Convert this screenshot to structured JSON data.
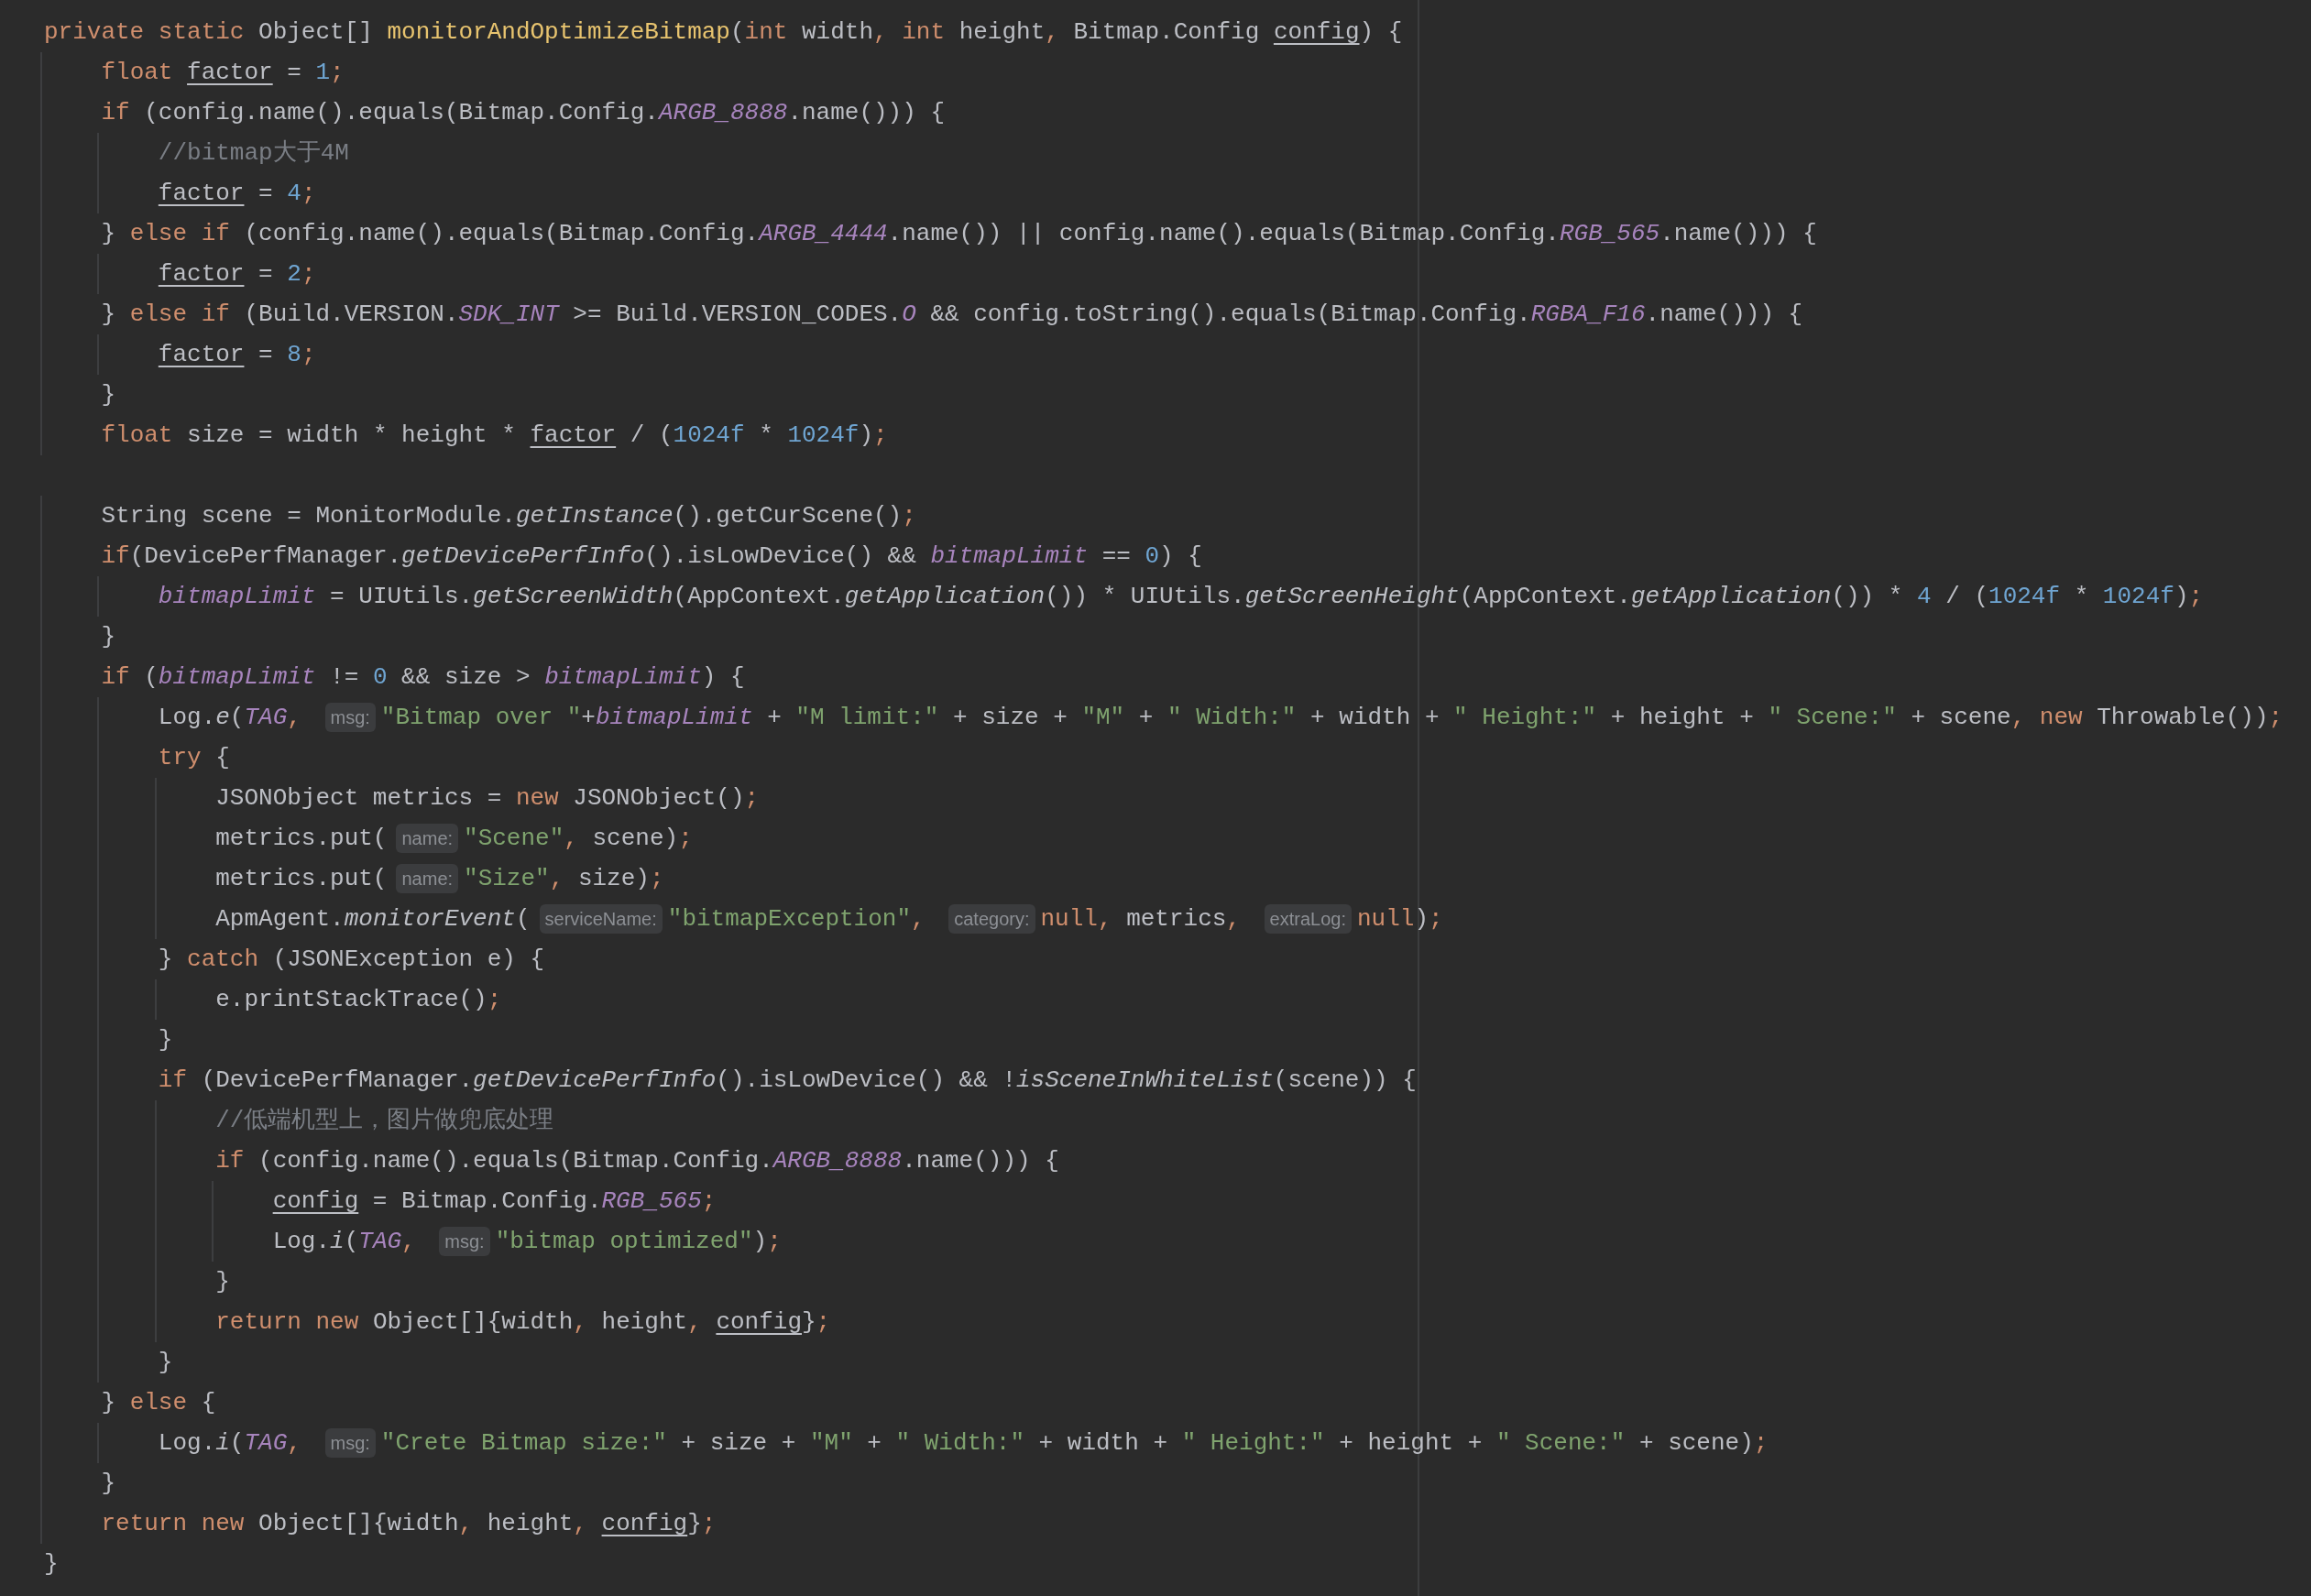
{
  "editor": {
    "lines": [
      {
        "tokens": [
          {
            "kind": "kw",
            "text": "private static "
          },
          {
            "kind": "id",
            "text": "Object[] "
          },
          {
            "kind": "fn",
            "text": "monitorAndOptimizeBitmap"
          },
          {
            "kind": "id",
            "text": "("
          },
          {
            "kind": "kw",
            "text": "int "
          },
          {
            "kind": "id",
            "text": "width"
          },
          {
            "kind": "kw",
            "text": ", int "
          },
          {
            "kind": "id",
            "text": "height"
          },
          {
            "kind": "kw",
            "text": ", "
          },
          {
            "kind": "id",
            "text": "Bitmap.Config "
          },
          {
            "kind": "var",
            "text": "config"
          },
          {
            "kind": "id",
            "text": ") {"
          }
        ]
      },
      {
        "tokens": [
          {
            "kind": "kw",
            "text": "    float "
          },
          {
            "kind": "var",
            "text": "factor"
          },
          {
            "kind": "id",
            "text": " = "
          },
          {
            "kind": "num",
            "text": "1"
          },
          {
            "kind": "kw",
            "text": ";"
          }
        ]
      },
      {
        "tokens": [
          {
            "kind": "kw",
            "text": "    if "
          },
          {
            "kind": "id",
            "text": "(config.name().equals(Bitmap.Config."
          },
          {
            "kind": "const",
            "text": "ARGB_8888"
          },
          {
            "kind": "id",
            "text": ".name())) {"
          }
        ]
      },
      {
        "tokens": [
          {
            "kind": "cmt",
            "text": "        //bitmap大于4M"
          }
        ]
      },
      {
        "tokens": [
          {
            "kind": "var",
            "text": "        factor"
          },
          {
            "kind": "id",
            "text": " = "
          },
          {
            "kind": "num",
            "text": "4"
          },
          {
            "kind": "kw",
            "text": ";"
          }
        ]
      },
      {
        "tokens": [
          {
            "kind": "id",
            "text": "    } "
          },
          {
            "kind": "kw",
            "text": "else if "
          },
          {
            "kind": "id",
            "text": "(config.name().equals(Bitmap.Config."
          },
          {
            "kind": "const",
            "text": "ARGB_4444"
          },
          {
            "kind": "id",
            "text": ".name()) || config.name().equals(Bitmap.Config."
          },
          {
            "kind": "const",
            "text": "RGB_565"
          },
          {
            "kind": "id",
            "text": ".name())) {"
          }
        ]
      },
      {
        "tokens": [
          {
            "kind": "var",
            "text": "        factor"
          },
          {
            "kind": "id",
            "text": " = "
          },
          {
            "kind": "num",
            "text": "2"
          },
          {
            "kind": "kw",
            "text": ";"
          }
        ]
      },
      {
        "tokens": [
          {
            "kind": "id",
            "text": "    } "
          },
          {
            "kind": "kw",
            "text": "else if "
          },
          {
            "kind": "id",
            "text": "(Build.VERSION."
          },
          {
            "kind": "const",
            "text": "SDK_INT"
          },
          {
            "kind": "id",
            "text": " >= Build.VERSION_CODES."
          },
          {
            "kind": "const",
            "text": "O"
          },
          {
            "kind": "id",
            "text": " && config.toString().equals(Bitmap.Config."
          },
          {
            "kind": "const",
            "text": "RGBA_F16"
          },
          {
            "kind": "id",
            "text": ".name())) {"
          }
        ]
      },
      {
        "tokens": [
          {
            "kind": "var",
            "text": "        factor"
          },
          {
            "kind": "id",
            "text": " = "
          },
          {
            "kind": "num",
            "text": "8"
          },
          {
            "kind": "kw",
            "text": ";"
          }
        ]
      },
      {
        "tokens": [
          {
            "kind": "id",
            "text": "    }"
          }
        ]
      },
      {
        "tokens": [
          {
            "kind": "kw",
            "text": "    float "
          },
          {
            "kind": "id",
            "text": "size = width * height * "
          },
          {
            "kind": "var",
            "text": "factor"
          },
          {
            "kind": "id",
            "text": " / ("
          },
          {
            "kind": "num",
            "text": "1024f"
          },
          {
            "kind": "id",
            "text": " * "
          },
          {
            "kind": "num",
            "text": "1024f"
          },
          {
            "kind": "id",
            "text": ")"
          },
          {
            "kind": "kw",
            "text": ";"
          }
        ]
      },
      {
        "blank": true
      },
      {
        "tokens": [
          {
            "kind": "id",
            "text": "    String scene = MonitorModule."
          },
          {
            "kind": "call",
            "text": "getInstance"
          },
          {
            "kind": "id",
            "text": "().getCurScene()"
          },
          {
            "kind": "kw",
            "text": ";"
          }
        ]
      },
      {
        "tokens": [
          {
            "kind": "kw",
            "text": "    if"
          },
          {
            "kind": "id",
            "text": "(DevicePerfManager."
          },
          {
            "kind": "call",
            "text": "getDevicePerfInfo"
          },
          {
            "kind": "id",
            "text": "().isLowDevice() && "
          },
          {
            "kind": "const",
            "text": "bitmapLimit"
          },
          {
            "kind": "id",
            "text": " == "
          },
          {
            "kind": "num",
            "text": "0"
          },
          {
            "kind": "id",
            "text": ") {"
          }
        ]
      },
      {
        "tokens": [
          {
            "kind": "const",
            "text": "        bitmapLimit"
          },
          {
            "kind": "id",
            "text": " = UIUtils."
          },
          {
            "kind": "call",
            "text": "getScreenWidth"
          },
          {
            "kind": "id",
            "text": "(AppContext."
          },
          {
            "kind": "call",
            "text": "getApplication"
          },
          {
            "kind": "id",
            "text": "()) * UIUtils."
          },
          {
            "kind": "call",
            "text": "getScreenHeight"
          },
          {
            "kind": "id",
            "text": "(AppContext."
          },
          {
            "kind": "call",
            "text": "getApplication"
          },
          {
            "kind": "id",
            "text": "()) * "
          },
          {
            "kind": "num",
            "text": "4"
          },
          {
            "kind": "id",
            "text": " / ("
          },
          {
            "kind": "num",
            "text": "1024f"
          },
          {
            "kind": "id",
            "text": " * "
          },
          {
            "kind": "num",
            "text": "1024f"
          },
          {
            "kind": "id",
            "text": ")"
          },
          {
            "kind": "kw",
            "text": ";"
          }
        ]
      },
      {
        "tokens": [
          {
            "kind": "id",
            "text": "    }"
          }
        ]
      },
      {
        "tokens": [
          {
            "kind": "kw",
            "text": "    if "
          },
          {
            "kind": "id",
            "text": "("
          },
          {
            "kind": "const",
            "text": "bitmapLimit"
          },
          {
            "kind": "id",
            "text": " != "
          },
          {
            "kind": "num",
            "text": "0"
          },
          {
            "kind": "id",
            "text": " && size > "
          },
          {
            "kind": "const",
            "text": "bitmapLimit"
          },
          {
            "kind": "id",
            "text": ") {"
          }
        ]
      },
      {
        "tokens": [
          {
            "kind": "id",
            "text": "        Log."
          },
          {
            "kind": "call",
            "text": "e"
          },
          {
            "kind": "id",
            "text": "("
          },
          {
            "kind": "const",
            "text": "TAG"
          },
          {
            "kind": "kw",
            "text": ", "
          },
          {
            "kind": "hint",
            "text": "msg:"
          },
          {
            "kind": "str",
            "text": "\"Bitmap over \""
          },
          {
            "kind": "id",
            "text": "+"
          },
          {
            "kind": "const",
            "text": "bitmapLimit"
          },
          {
            "kind": "id",
            "text": " + "
          },
          {
            "kind": "str",
            "text": "\"M limit:\""
          },
          {
            "kind": "id",
            "text": " + size + "
          },
          {
            "kind": "str",
            "text": "\"M\""
          },
          {
            "kind": "id",
            "text": " + "
          },
          {
            "kind": "str",
            "text": "\" Width:\""
          },
          {
            "kind": "id",
            "text": " + width + "
          },
          {
            "kind": "str",
            "text": "\" Height:\""
          },
          {
            "kind": "id",
            "text": " + height + "
          },
          {
            "kind": "str",
            "text": "\" Scene:\""
          },
          {
            "kind": "id",
            "text": " + scene"
          },
          {
            "kind": "kw",
            "text": ", new "
          },
          {
            "kind": "id",
            "text": "Throwable())"
          },
          {
            "kind": "kw",
            "text": ";"
          }
        ]
      },
      {
        "tokens": [
          {
            "kind": "kw",
            "text": "        try "
          },
          {
            "kind": "id",
            "text": "{"
          }
        ]
      },
      {
        "tokens": [
          {
            "kind": "id",
            "text": "            JSONObject metrics = "
          },
          {
            "kind": "kw",
            "text": "new "
          },
          {
            "kind": "id",
            "text": "JSONObject()"
          },
          {
            "kind": "kw",
            "text": ";"
          }
        ]
      },
      {
        "tokens": [
          {
            "kind": "id",
            "text": "            metrics.put("
          },
          {
            "kind": "hint",
            "text": "name:"
          },
          {
            "kind": "str",
            "text": "\"Scene\""
          },
          {
            "kind": "kw",
            "text": ", "
          },
          {
            "kind": "id",
            "text": "scene)"
          },
          {
            "kind": "kw",
            "text": ";"
          }
        ]
      },
      {
        "tokens": [
          {
            "kind": "id",
            "text": "            metrics.put("
          },
          {
            "kind": "hint",
            "text": "name:"
          },
          {
            "kind": "str",
            "text": "\"Size\""
          },
          {
            "kind": "kw",
            "text": ", "
          },
          {
            "kind": "id",
            "text": "size)"
          },
          {
            "kind": "kw",
            "text": ";"
          }
        ]
      },
      {
        "tokens": [
          {
            "kind": "id",
            "text": "            ApmAgent."
          },
          {
            "kind": "call",
            "text": "monitorEvent"
          },
          {
            "kind": "id",
            "text": "("
          },
          {
            "kind": "hint",
            "text": "serviceName:"
          },
          {
            "kind": "str",
            "text": "\"bitmapException\""
          },
          {
            "kind": "kw",
            "text": ", "
          },
          {
            "kind": "hint",
            "text": "category:"
          },
          {
            "kind": "kw",
            "text": "null, "
          },
          {
            "kind": "id",
            "text": "metrics"
          },
          {
            "kind": "kw",
            "text": ", "
          },
          {
            "kind": "hint",
            "text": "extraLog:"
          },
          {
            "kind": "kw",
            "text": "null"
          },
          {
            "kind": "id",
            "text": ")"
          },
          {
            "kind": "kw",
            "text": ";"
          }
        ]
      },
      {
        "tokens": [
          {
            "kind": "id",
            "text": "        } "
          },
          {
            "kind": "kw",
            "text": "catch "
          },
          {
            "kind": "id",
            "text": "(JSONException e) {"
          }
        ]
      },
      {
        "tokens": [
          {
            "kind": "id",
            "text": "            e.printStackTrace()"
          },
          {
            "kind": "kw",
            "text": ";"
          }
        ]
      },
      {
        "tokens": [
          {
            "kind": "id",
            "text": "        }"
          }
        ]
      },
      {
        "tokens": [
          {
            "kind": "kw",
            "text": "        if "
          },
          {
            "kind": "id",
            "text": "(DevicePerfManager."
          },
          {
            "kind": "call",
            "text": "getDevicePerfInfo"
          },
          {
            "kind": "id",
            "text": "().isLowDevice() && !"
          },
          {
            "kind": "call",
            "text": "isSceneInWhiteList"
          },
          {
            "kind": "id",
            "text": "(scene)) {"
          }
        ]
      },
      {
        "tokens": [
          {
            "kind": "cmt",
            "text": "            //低端机型上，图片做兜底处理"
          }
        ]
      },
      {
        "tokens": [
          {
            "kind": "kw",
            "text": "            if "
          },
          {
            "kind": "id",
            "text": "(config.name().equals(Bitmap.Config."
          },
          {
            "kind": "const",
            "text": "ARGB_8888"
          },
          {
            "kind": "id",
            "text": ".name())) {"
          }
        ]
      },
      {
        "tokens": [
          {
            "kind": "var",
            "text": "                config"
          },
          {
            "kind": "id",
            "text": " = Bitmap.Config."
          },
          {
            "kind": "const",
            "text": "RGB_565"
          },
          {
            "kind": "kw",
            "text": ";"
          }
        ]
      },
      {
        "tokens": [
          {
            "kind": "id",
            "text": "                Log."
          },
          {
            "kind": "call",
            "text": "i"
          },
          {
            "kind": "id",
            "text": "("
          },
          {
            "kind": "const",
            "text": "TAG"
          },
          {
            "kind": "kw",
            "text": ", "
          },
          {
            "kind": "hint",
            "text": "msg:"
          },
          {
            "kind": "str",
            "text": "\"bitmap optimized\""
          },
          {
            "kind": "id",
            "text": ")"
          },
          {
            "kind": "kw",
            "text": ";"
          }
        ]
      },
      {
        "tokens": [
          {
            "kind": "id",
            "text": "            }"
          }
        ]
      },
      {
        "tokens": [
          {
            "kind": "kw",
            "text": "            return new "
          },
          {
            "kind": "id",
            "text": "Object[]{width"
          },
          {
            "kind": "kw",
            "text": ", "
          },
          {
            "kind": "id",
            "text": "height"
          },
          {
            "kind": "kw",
            "text": ", "
          },
          {
            "kind": "var",
            "text": "config"
          },
          {
            "kind": "id",
            "text": "}"
          },
          {
            "kind": "kw",
            "text": ";"
          }
        ]
      },
      {
        "tokens": [
          {
            "kind": "id",
            "text": "        }"
          }
        ]
      },
      {
        "tokens": [
          {
            "kind": "id",
            "text": "    } "
          },
          {
            "kind": "kw",
            "text": "else "
          },
          {
            "kind": "id",
            "text": "{"
          }
        ]
      },
      {
        "tokens": [
          {
            "kind": "id",
            "text": "        Log."
          },
          {
            "kind": "call",
            "text": "i"
          },
          {
            "kind": "id",
            "text": "("
          },
          {
            "kind": "const",
            "text": "TAG"
          },
          {
            "kind": "kw",
            "text": ", "
          },
          {
            "kind": "hint",
            "text": "msg:"
          },
          {
            "kind": "str",
            "text": "\"Crete Bitmap size:\""
          },
          {
            "kind": "id",
            "text": " + size + "
          },
          {
            "kind": "str",
            "text": "\"M\""
          },
          {
            "kind": "id",
            "text": " + "
          },
          {
            "kind": "str",
            "text": "\" Width:\""
          },
          {
            "kind": "id",
            "text": " + width + "
          },
          {
            "kind": "str",
            "text": "\" Height:\""
          },
          {
            "kind": "id",
            "text": " + height + "
          },
          {
            "kind": "str",
            "text": "\" Scene:\""
          },
          {
            "kind": "id",
            "text": " + scene)"
          },
          {
            "kind": "kw",
            "text": ";"
          }
        ]
      },
      {
        "tokens": [
          {
            "kind": "id",
            "text": "    }"
          }
        ]
      },
      {
        "tokens": [
          {
            "kind": "kw",
            "text": "    return new "
          },
          {
            "kind": "id",
            "text": "Object[]{width"
          },
          {
            "kind": "kw",
            "text": ", "
          },
          {
            "kind": "id",
            "text": "height"
          },
          {
            "kind": "kw",
            "text": ", "
          },
          {
            "kind": "var",
            "text": "config"
          },
          {
            "kind": "id",
            "text": "}"
          },
          {
            "kind": "kw",
            "text": ";"
          }
        ]
      },
      {
        "tokens": [
          {
            "kind": "id",
            "text": "}"
          }
        ]
      }
    ]
  }
}
